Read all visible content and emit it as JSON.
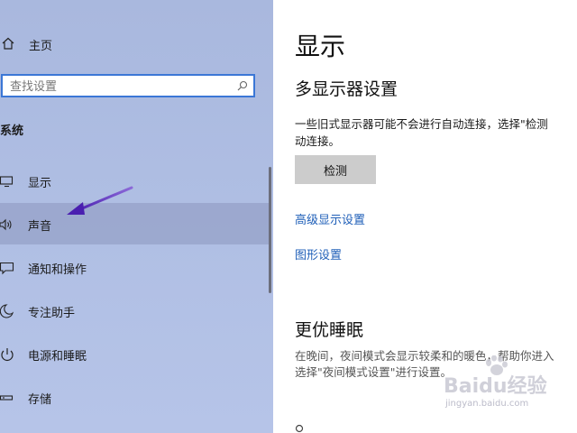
{
  "sidebar": {
    "home_label": "主页",
    "search_placeholder": "查找设置",
    "section_title": "系统",
    "items": [
      {
        "label": "显示",
        "icon": "monitor-icon"
      },
      {
        "label": "声音",
        "icon": "speaker-icon"
      },
      {
        "label": "通知和操作",
        "icon": "notification-icon"
      },
      {
        "label": "专注助手",
        "icon": "moon-icon"
      },
      {
        "label": "电源和睡眠",
        "icon": "power-icon"
      },
      {
        "label": "存储",
        "icon": "storage-icon"
      }
    ],
    "selected_index": 1
  },
  "main": {
    "title": "显示",
    "multi_display_heading": "多显示器设置",
    "multi_display_text_line1": "一些旧式显示器可能不会进行自动连接，选择\"检测",
    "multi_display_text_line2": "动连接。",
    "detect_button_label": "检测",
    "advanced_link": "高级显示设置",
    "graphics_link": "图形设置",
    "sleep_heading": "更优睡眠",
    "sleep_text_line1": "在晚间，夜间模式会显示较柔和的暖色，帮助你进入",
    "sleep_text_line2": "选择\"夜间模式设置\"进行设置。"
  },
  "watermark": {
    "brand": "Baidu经验",
    "sub": "jingyan.baidu.com"
  },
  "colors": {
    "sidebar_bg": "#aebde2",
    "search_border": "#3b77d6",
    "link": "#1f5fb8",
    "button_bg": "#cccccc",
    "arrow": "#6a2fd0"
  }
}
